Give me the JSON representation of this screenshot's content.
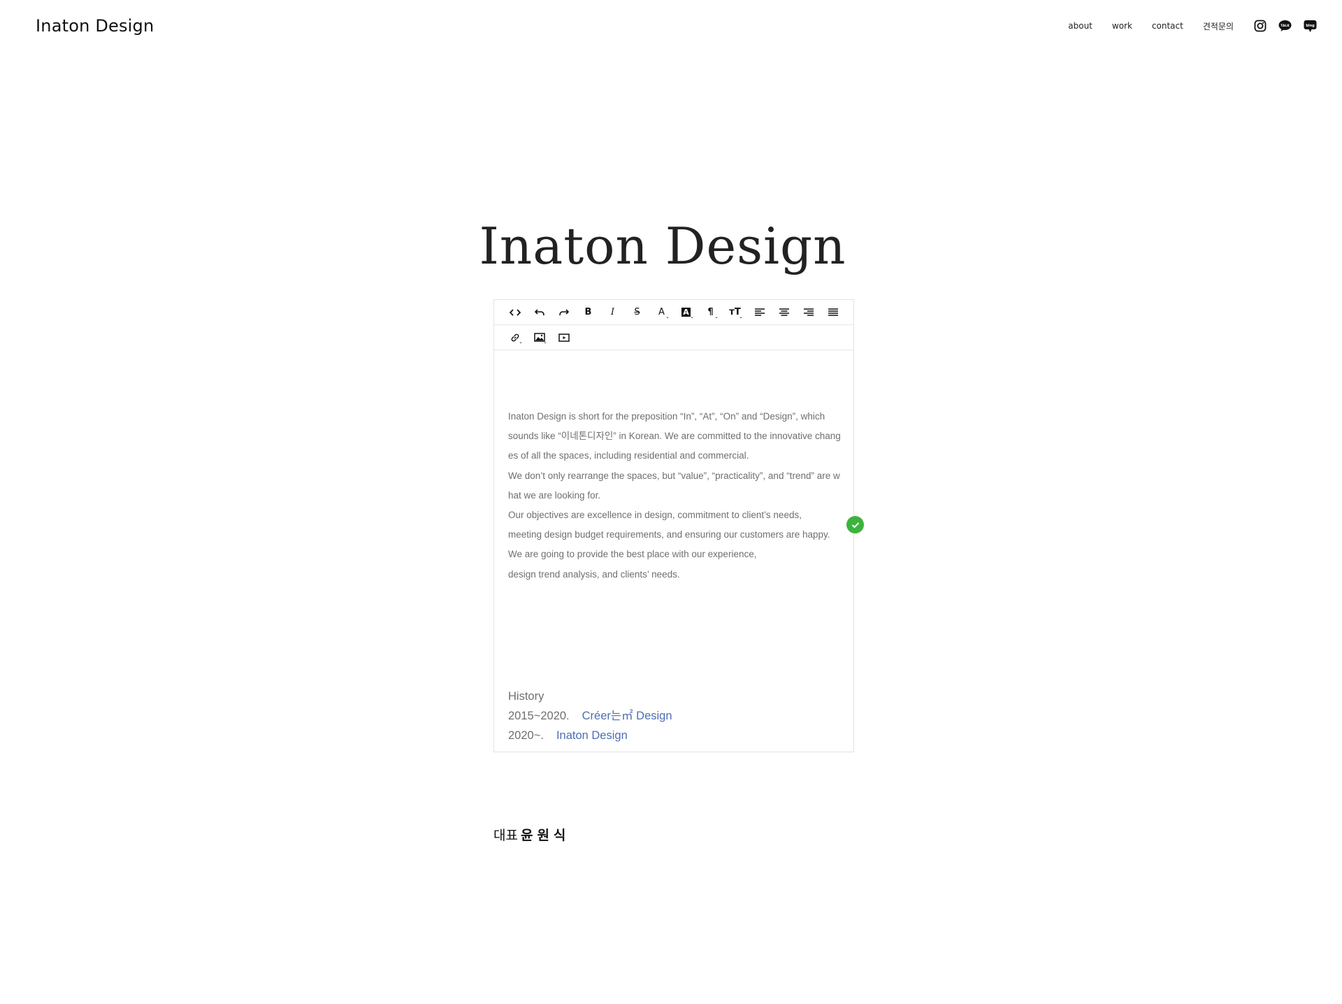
{
  "header": {
    "logo": "Inaton Design",
    "nav": [
      {
        "label": "about"
      },
      {
        "label": "work"
      },
      {
        "label": "contact"
      },
      {
        "label": "견적문의"
      }
    ],
    "social": [
      {
        "icon": "instagram-icon"
      },
      {
        "icon": "kakaotalk-icon",
        "label": "TALK"
      },
      {
        "icon": "blog-icon",
        "label": "blog"
      }
    ]
  },
  "hero": {
    "title": "Inaton Design"
  },
  "editor": {
    "toolbar": {
      "row1": [
        "code-view",
        "undo",
        "redo",
        "bold",
        "italic",
        "strikethrough",
        "font-color",
        "highlight",
        "paragraph",
        "font-size",
        "align-left",
        "align-center",
        "align-right",
        "justify"
      ],
      "row2": [
        "link",
        "image",
        "video"
      ],
      "bold_label": "B",
      "italic_label": "I",
      "strike_label": "S",
      "color_label": "A",
      "highlight_label": "A",
      "paragraph_label": "¶",
      "fontsize_label": "ᴛT"
    },
    "body_lines": [
      "Inaton Design is short for the preposition “In”, “At”, “On” and “Design”, which",
      "sounds like “이네톤디자인” in Korean. We are committed to the innovative changes of all the spaces, including residential and commercial.",
      "We don’t only rearrange the spaces, but “value”, “practicality”, and “trend” are what we are looking for.",
      "Our objectives are excellence in design, commitment to client’s needs,",
      "meeting design budget requirements, and ensuring our customers are happy.",
      "We are going to provide the best place with our experience,",
      "design trend analysis, and clients’ needs."
    ],
    "history": {
      "heading": "History",
      "items": [
        {
          "period": "2015~2020.",
          "company": "Créer는㎡ Design"
        },
        {
          "period": "2020~.",
          "company": "Inaton Design"
        }
      ]
    }
  },
  "ceo": {
    "title": "대표",
    "name": "윤원식"
  },
  "colors": {
    "link": "#4d6fb3",
    "save_badge": "#3db33d",
    "body_text": "#6f6f6f"
  }
}
